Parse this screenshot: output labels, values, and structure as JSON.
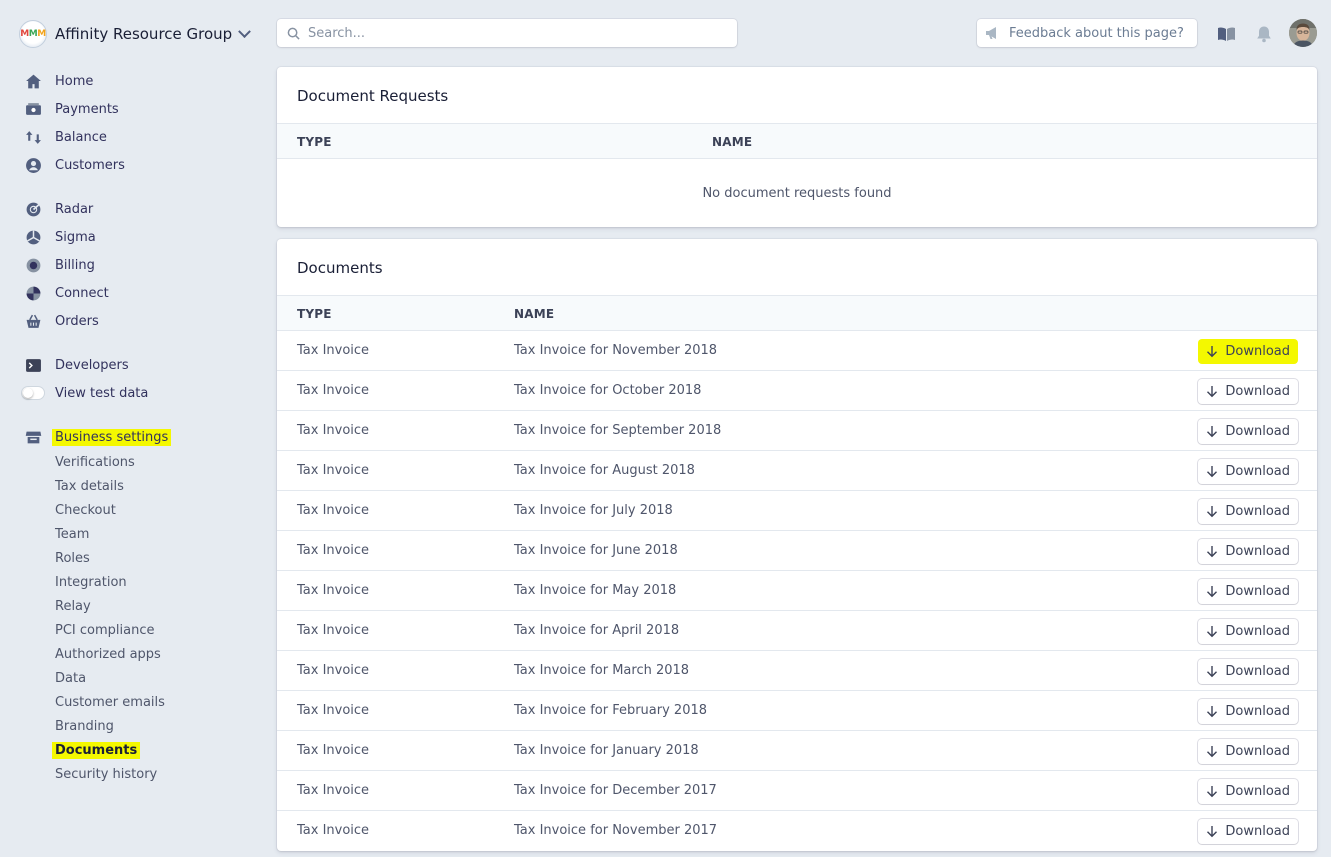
{
  "account": {
    "logo_text": [
      "M",
      "M",
      "M"
    ],
    "name": "Affinity Resource Group"
  },
  "search": {
    "placeholder": "Search..."
  },
  "header": {
    "feedback_label": "Feedback about this page?"
  },
  "nav": {
    "primary": [
      {
        "label": "Home",
        "icon": "home-icon"
      },
      {
        "label": "Payments",
        "icon": "payments-icon"
      },
      {
        "label": "Balance",
        "icon": "balance-icon"
      },
      {
        "label": "Customers",
        "icon": "customers-icon"
      }
    ],
    "products": [
      {
        "label": "Radar",
        "icon": "radar-icon"
      },
      {
        "label": "Sigma",
        "icon": "sigma-icon"
      },
      {
        "label": "Billing",
        "icon": "billing-icon"
      },
      {
        "label": "Connect",
        "icon": "connect-icon"
      },
      {
        "label": "Orders",
        "icon": "orders-icon"
      }
    ],
    "developers": {
      "label": "Developers",
      "icon": "terminal-icon"
    },
    "test_data": {
      "label": "View test data",
      "enabled": false
    },
    "business_settings": {
      "label": "Business settings",
      "icon": "store-icon",
      "highlight_color": "#f4f800",
      "items": [
        "Verifications",
        "Tax details",
        "Checkout",
        "Team",
        "Roles",
        "Integration",
        "Relay",
        "PCI compliance",
        "Authorized apps",
        "Data",
        "Customer emails",
        "Branding",
        "Documents",
        "Security history"
      ],
      "active_item": "Documents"
    }
  },
  "document_requests": {
    "title": "Document Requests",
    "columns": [
      "TYPE",
      "NAME"
    ],
    "empty_message": "No document requests found"
  },
  "documents": {
    "title": "Documents",
    "columns": [
      "TYPE",
      "NAME"
    ],
    "download_label": "Download",
    "rows": [
      {
        "type": "Tax Invoice",
        "name": "Tax Invoice for November 2018"
      },
      {
        "type": "Tax Invoice",
        "name": "Tax Invoice for October 2018"
      },
      {
        "type": "Tax Invoice",
        "name": "Tax Invoice for September 2018"
      },
      {
        "type": "Tax Invoice",
        "name": "Tax Invoice for August 2018"
      },
      {
        "type": "Tax Invoice",
        "name": "Tax Invoice for July 2018"
      },
      {
        "type": "Tax Invoice",
        "name": "Tax Invoice for June 2018"
      },
      {
        "type": "Tax Invoice",
        "name": "Tax Invoice for May 2018"
      },
      {
        "type": "Tax Invoice",
        "name": "Tax Invoice for April 2018"
      },
      {
        "type": "Tax Invoice",
        "name": "Tax Invoice for March 2018"
      },
      {
        "type": "Tax Invoice",
        "name": "Tax Invoice for February 2018"
      },
      {
        "type": "Tax Invoice",
        "name": "Tax Invoice for January 2018"
      },
      {
        "type": "Tax Invoice",
        "name": "Tax Invoice for December 2017"
      },
      {
        "type": "Tax Invoice",
        "name": "Tax Invoice for November 2017"
      }
    ],
    "highlighted_row": 0
  },
  "colors": {
    "background": "#e6ebf1",
    "highlight": "#f4f800",
    "text": "#32325d",
    "icon": "#525f7f"
  }
}
